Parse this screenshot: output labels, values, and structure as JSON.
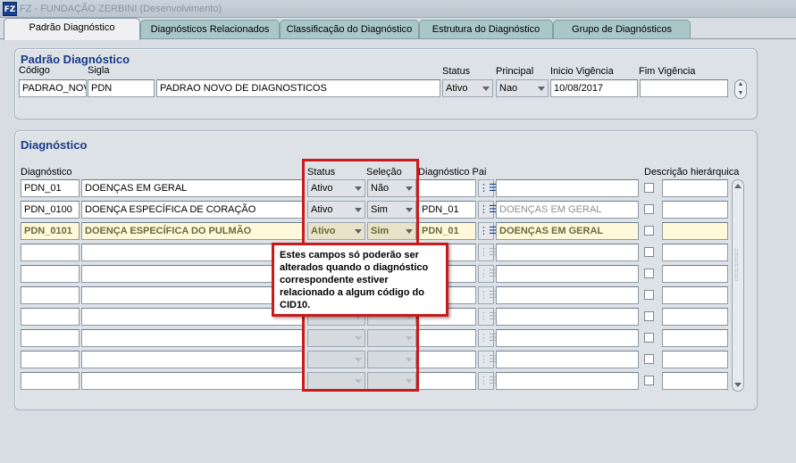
{
  "window": {
    "title": "FZ - FUNDAÇÃO ZERBINI (Desenvolvimento)",
    "icon": "app-icon"
  },
  "tabs": [
    {
      "label": "Padrão Diagnóstico",
      "active": true
    },
    {
      "label": "Diagnósticos Relacionados",
      "active": false
    },
    {
      "label": "Classificação do Diagnóstico",
      "active": false
    },
    {
      "label": "Estrutura do Diagnóstico",
      "active": false
    },
    {
      "label": "Grupo de Diagnósticos",
      "active": false
    }
  ],
  "padrao": {
    "title": "Padrão Diagnóstico",
    "labels": {
      "codigo": "Código",
      "sigla": "Sigla",
      "status": "Status",
      "principal": "Principal",
      "inicio": "Inicio Vigência",
      "fim": "Fim Vigência"
    },
    "values": {
      "codigo": "PADRAO_NOV",
      "sigla": "PDN",
      "descricao": "PADRAO NOVO DE DIAGNOSTICOS",
      "status": "Ativo",
      "principal": "Nao",
      "inicio": "10/08/2017",
      "fim": ""
    }
  },
  "diagnostico": {
    "title": "Diagnóstico",
    "headers": {
      "diagnostico": "Diagnóstico",
      "status": "Status",
      "selecao": "Seleção",
      "pai": "Diagnóstico Pai",
      "hierarquica": "Descrição hierárquica"
    },
    "rows": [
      {
        "code": "PDN_01",
        "desc": "DOENÇAS EM GERAL",
        "status": "Ativo",
        "selecao": "Não",
        "pai_code": "",
        "pai_desc": "",
        "hier": ""
      },
      {
        "code": "PDN_0100",
        "desc": "DOENÇA ESPECÍFICA DE CORAÇÃO",
        "status": "Ativo",
        "selecao": "Sim",
        "pai_code": "PDN_01",
        "pai_desc": "DOENÇAS EM GERAL",
        "hier": ""
      },
      {
        "code": "PDN_0101",
        "desc": "DOENÇA ESPECÍFICA DO PULMÃO",
        "status": "Ativo",
        "selecao": "Sim",
        "pai_code": "PDN_01",
        "pai_desc": "DOENÇAS EM GERAL",
        "hier": ""
      },
      {
        "code": "",
        "desc": "",
        "status": "",
        "selecao": "",
        "pai_code": "",
        "pai_desc": "",
        "hier": ""
      },
      {
        "code": "",
        "desc": "",
        "status": "",
        "selecao": "",
        "pai_code": "",
        "pai_desc": "",
        "hier": ""
      },
      {
        "code": "",
        "desc": "",
        "status": "",
        "selecao": "",
        "pai_code": "",
        "pai_desc": "",
        "hier": ""
      },
      {
        "code": "",
        "desc": "",
        "status": "",
        "selecao": "",
        "pai_code": "",
        "pai_desc": "",
        "hier": ""
      },
      {
        "code": "",
        "desc": "",
        "status": "",
        "selecao": "",
        "pai_code": "",
        "pai_desc": "",
        "hier": ""
      },
      {
        "code": "",
        "desc": "",
        "status": "",
        "selecao": "",
        "pai_code": "",
        "pai_desc": "",
        "hier": ""
      },
      {
        "code": "",
        "desc": "",
        "status": "",
        "selecao": "",
        "pai_code": "",
        "pai_desc": "",
        "hier": ""
      }
    ],
    "highlighted_row": 2
  },
  "annotation": {
    "text": "Estes campos só poderão ser alterados quando o diagnóstico correspondente estiver relacionado a algum código do CID10.",
    "color": "#cc1a1a"
  }
}
